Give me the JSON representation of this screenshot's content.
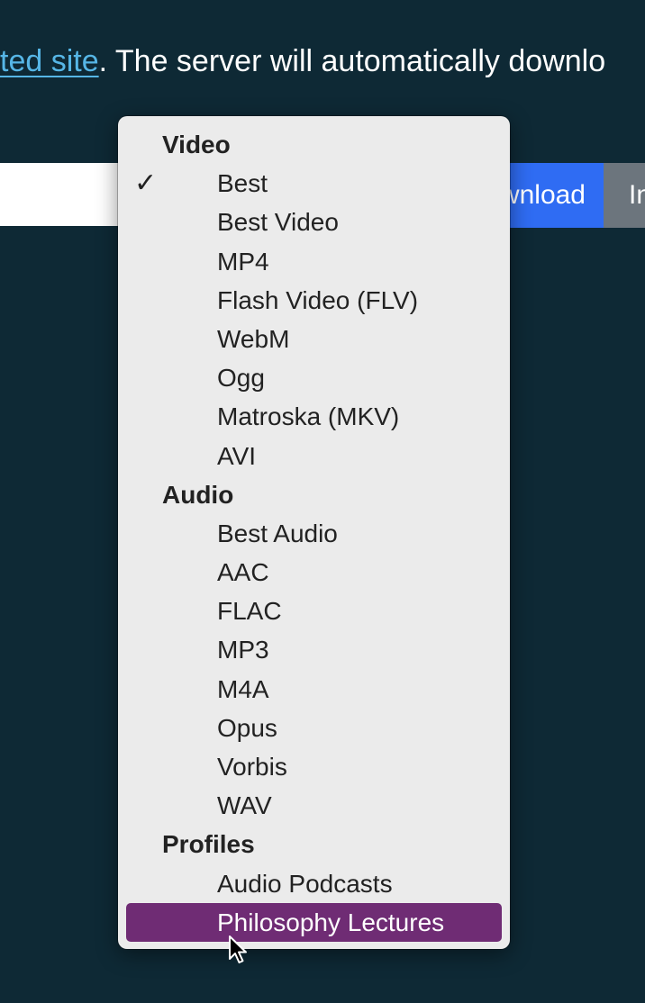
{
  "intro": {
    "link_text": "ted site",
    "rest_text": ". The server will automatically downlo"
  },
  "url_input": {
    "value": "",
    "placeholder": ""
  },
  "buttons": {
    "download": "Download",
    "info": "Info"
  },
  "format_menu": {
    "selected": "Best",
    "highlighted": "Philosophy Lectures",
    "check_glyph": "✓",
    "groups": [
      {
        "label": "Video",
        "items": [
          "Best",
          "Best Video",
          "MP4",
          "Flash Video (FLV)",
          "WebM",
          "Ogg",
          "Matroska (MKV)",
          "AVI"
        ]
      },
      {
        "label": "Audio",
        "items": [
          "Best Audio",
          "AAC",
          "FLAC",
          "MP3",
          "M4A",
          "Opus",
          "Vorbis",
          "WAV"
        ]
      },
      {
        "label": "Profiles",
        "items": [
          "Audio Podcasts",
          "Philosophy Lectures"
        ]
      }
    ]
  },
  "colors": {
    "page_background": "#0e2935",
    "link": "#56b6e6",
    "download_button": "#2f6cf3",
    "info_button": "#6c757d",
    "menu_background": "#ebebeb",
    "highlight": "#6f2c74"
  },
  "icons": {
    "cursor": "arrow-cursor-icon",
    "check": "checkmark-icon"
  }
}
